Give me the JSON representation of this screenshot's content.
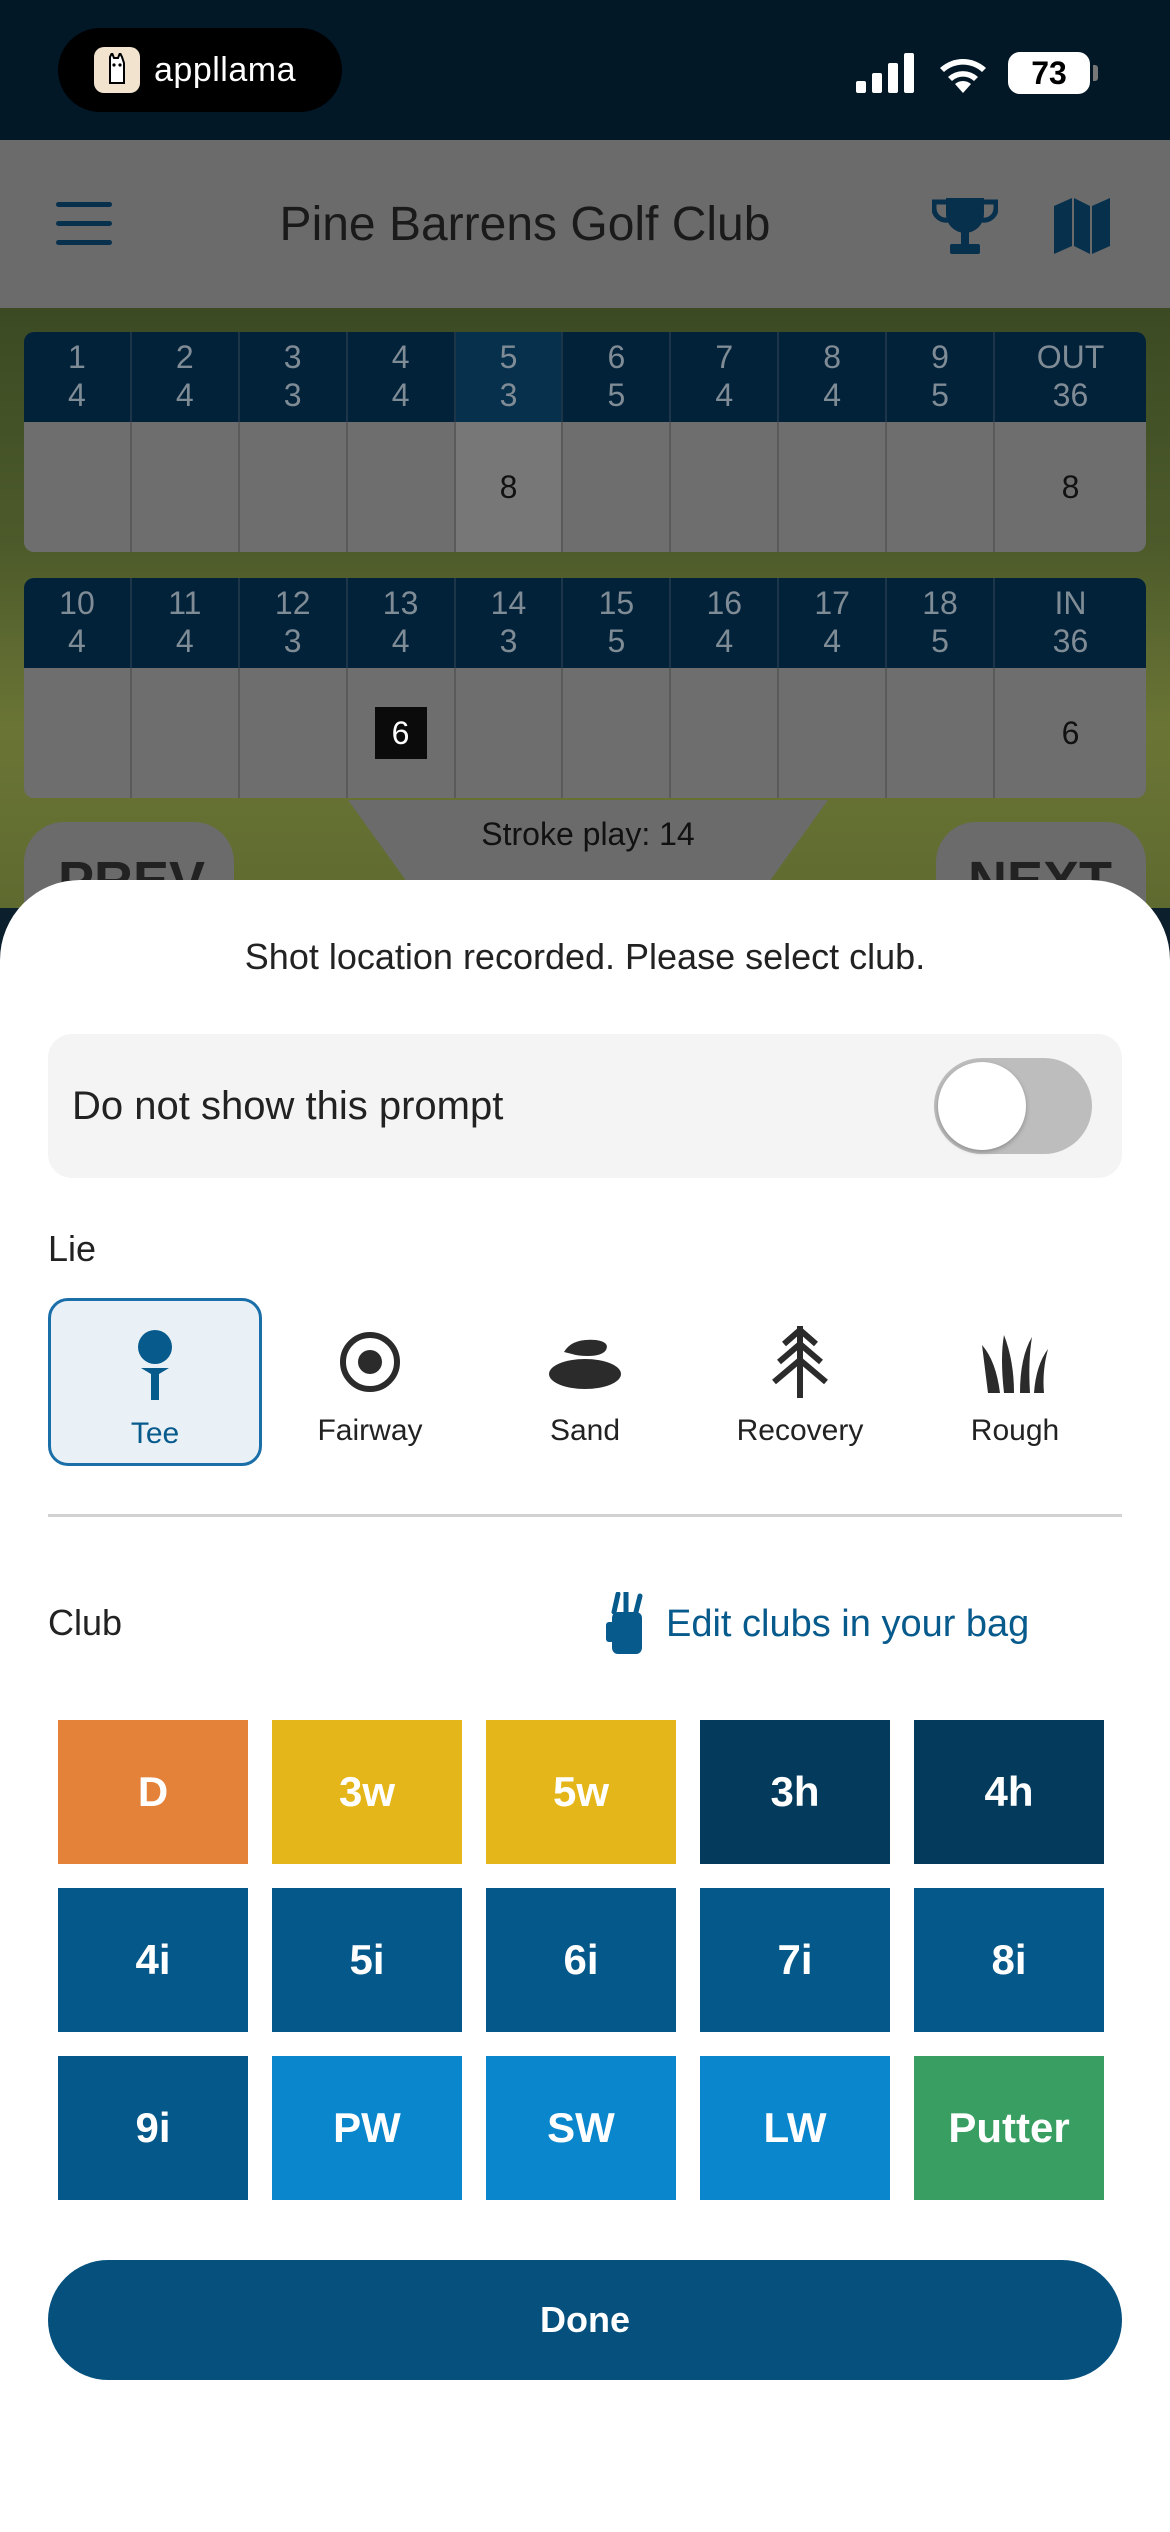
{
  "status_bar": {
    "app_name": "appllama",
    "battery": "73"
  },
  "header": {
    "title": "Pine Barrens Golf Club"
  },
  "scorecard": {
    "front": {
      "holes": [
        {
          "hole": "1",
          "par": "4",
          "score": ""
        },
        {
          "hole": "2",
          "par": "4",
          "score": ""
        },
        {
          "hole": "3",
          "par": "3",
          "score": ""
        },
        {
          "hole": "4",
          "par": "4",
          "score": ""
        },
        {
          "hole": "5",
          "par": "3",
          "score": "8"
        },
        {
          "hole": "6",
          "par": "5",
          "score": ""
        },
        {
          "hole": "7",
          "par": "4",
          "score": ""
        },
        {
          "hole": "8",
          "par": "4",
          "score": ""
        },
        {
          "hole": "9",
          "par": "5",
          "score": ""
        }
      ],
      "total_label": "OUT",
      "total_par": "36",
      "total_score": "8"
    },
    "back": {
      "holes": [
        {
          "hole": "10",
          "par": "4",
          "score": ""
        },
        {
          "hole": "11",
          "par": "4",
          "score": ""
        },
        {
          "hole": "12",
          "par": "3",
          "score": ""
        },
        {
          "hole": "13",
          "par": "4",
          "score": "6"
        },
        {
          "hole": "14",
          "par": "3",
          "score": ""
        },
        {
          "hole": "15",
          "par": "5",
          "score": ""
        },
        {
          "hole": "16",
          "par": "4",
          "score": ""
        },
        {
          "hole": "17",
          "par": "4",
          "score": ""
        },
        {
          "hole": "18",
          "par": "5",
          "score": ""
        }
      ],
      "total_label": "IN",
      "total_par": "36",
      "total_score": "6"
    },
    "stroke_play": "Stroke play: 14",
    "prev_label": "PREV",
    "next_label": "NEXT"
  },
  "sheet": {
    "prompt": "Shot location recorded. Please select club.",
    "toggle_label": "Do not show this prompt",
    "lie_label": "Lie",
    "lies": [
      {
        "label": "Tee",
        "icon": "tee-icon",
        "selected": true
      },
      {
        "label": "Fairway",
        "icon": "fairway-icon",
        "selected": false
      },
      {
        "label": "Sand",
        "icon": "sand-icon",
        "selected": false
      },
      {
        "label": "Recovery",
        "icon": "recovery-tree-icon",
        "selected": false
      },
      {
        "label": "Rough",
        "icon": "rough-grass-icon",
        "selected": false
      }
    ],
    "club_label": "Club",
    "edit_clubs": "Edit clubs in your bag",
    "clubs": [
      {
        "label": "D",
        "color": "#e4823a"
      },
      {
        "label": "3w",
        "color": "#e5b619"
      },
      {
        "label": "5w",
        "color": "#e5b619"
      },
      {
        "label": "3h",
        "color": "#043a5c"
      },
      {
        "label": "4h",
        "color": "#043a5c"
      },
      {
        "label": "4i",
        "color": "#05588a"
      },
      {
        "label": "5i",
        "color": "#05588a"
      },
      {
        "label": "6i",
        "color": "#05588a"
      },
      {
        "label": "7i",
        "color": "#05588a"
      },
      {
        "label": "8i",
        "color": "#05588a"
      },
      {
        "label": "9i",
        "color": "#05588a"
      },
      {
        "label": "PW",
        "color": "#0a86cc"
      },
      {
        "label": "SW",
        "color": "#0a86cc"
      },
      {
        "label": "LW",
        "color": "#0a86cc"
      },
      {
        "label": "Putter",
        "color": "#389e62"
      }
    ],
    "done_label": "Done"
  },
  "colors": {
    "accent": "#06507d",
    "link": "#075a8c"
  }
}
